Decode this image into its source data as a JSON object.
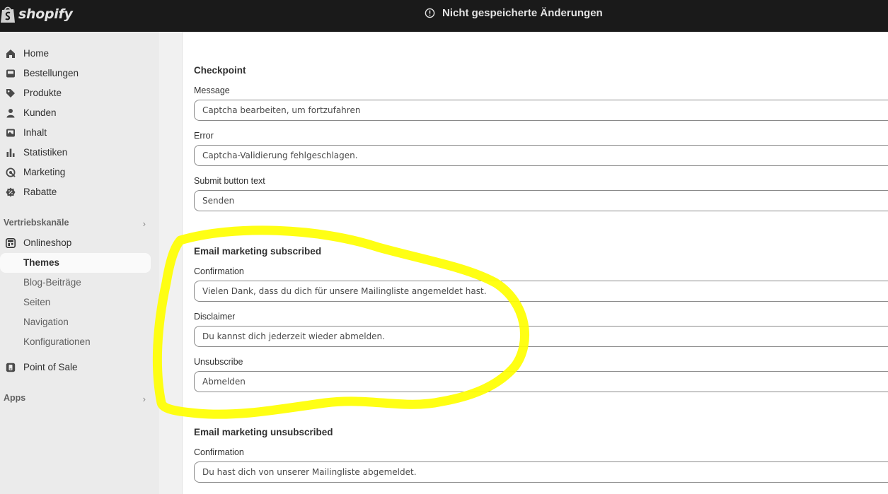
{
  "topbar": {
    "brand": "shopify",
    "unsaved_text": "Nicht gespeicherte Änderungen"
  },
  "sidebar": {
    "items": [
      {
        "label": "Home",
        "icon": "home-icon"
      },
      {
        "label": "Bestellungen",
        "icon": "inbox-icon"
      },
      {
        "label": "Produkte",
        "icon": "tag-icon"
      },
      {
        "label": "Kunden",
        "icon": "person-icon"
      },
      {
        "label": "Inhalt",
        "icon": "image-icon"
      },
      {
        "label": "Statistiken",
        "icon": "bar-chart-icon"
      },
      {
        "label": "Marketing",
        "icon": "target-icon"
      },
      {
        "label": "Rabatte",
        "icon": "discount-icon"
      }
    ],
    "sales_channels_title": "Vertriebskanäle",
    "online_store": "Onlineshop",
    "sub_items": [
      "Themes",
      "Blog-Beiträge",
      "Seiten",
      "Navigation",
      "Konfigurationen"
    ],
    "point_of_sale": "Point of Sale",
    "apps_title": "Apps"
  },
  "main": {
    "checkpoint": {
      "title": "Checkpoint",
      "message_label": "Message",
      "message_value": "Captcha bearbeiten, um fortzufahren",
      "error_label": "Error",
      "error_value": "Captcha-Validierung fehlgeschlagen.",
      "submit_label": "Submit button text",
      "submit_value": "Senden"
    },
    "subscribed": {
      "title": "Email marketing subscribed",
      "confirmation_label": "Confirmation",
      "confirmation_value": "Vielen Dank, dass du dich für unsere Mailingliste angemeldet hast.",
      "disclaimer_label": "Disclaimer",
      "disclaimer_value": "Du kannst dich jederzeit wieder abmelden.",
      "unsubscribe_label": "Unsubscribe",
      "unsubscribe_value": "Abmelden"
    },
    "unsubscribed": {
      "title": "Email marketing unsubscribed",
      "confirmation_label": "Confirmation",
      "confirmation_value": "Du hast dich von unserer Mailingliste abgemeldet."
    }
  },
  "colors": {
    "topbar": "#1a1a1a",
    "sidebar": "#ebebeb",
    "annotation": "#ffff00"
  }
}
